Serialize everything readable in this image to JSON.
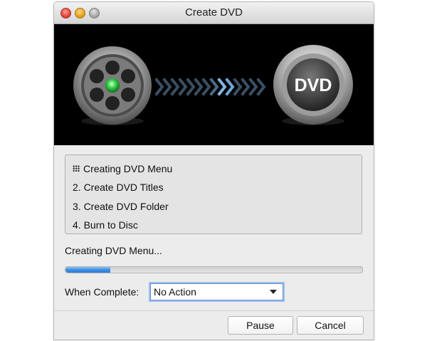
{
  "window": {
    "title": "Create DVD",
    "controls": [
      "close",
      "minimize",
      "zoom"
    ]
  },
  "banner": {
    "source_icon": "film-reel-icon",
    "target_icon": "dvd-disc-icon",
    "disc_label": "DVD"
  },
  "steps": [
    {
      "label": "Creating DVD Menu",
      "state": "active"
    },
    {
      "label": "2. Create DVD Titles",
      "state": "pending"
    },
    {
      "label": "3. Create DVD Folder",
      "state": "pending"
    },
    {
      "label": "4. Burn to Disc",
      "state": "pending"
    }
  ],
  "status": {
    "text": "Creating DVD Menu...",
    "progress_fraction": 0.15
  },
  "when_complete": {
    "label": "When Complete:",
    "selected": "No Action"
  },
  "buttons": {
    "pause": "Pause",
    "cancel": "Cancel"
  },
  "colors": {
    "banner_bg": "#000000",
    "progress": "#3f8fe0",
    "focus_ring": "#9cc0ee"
  }
}
